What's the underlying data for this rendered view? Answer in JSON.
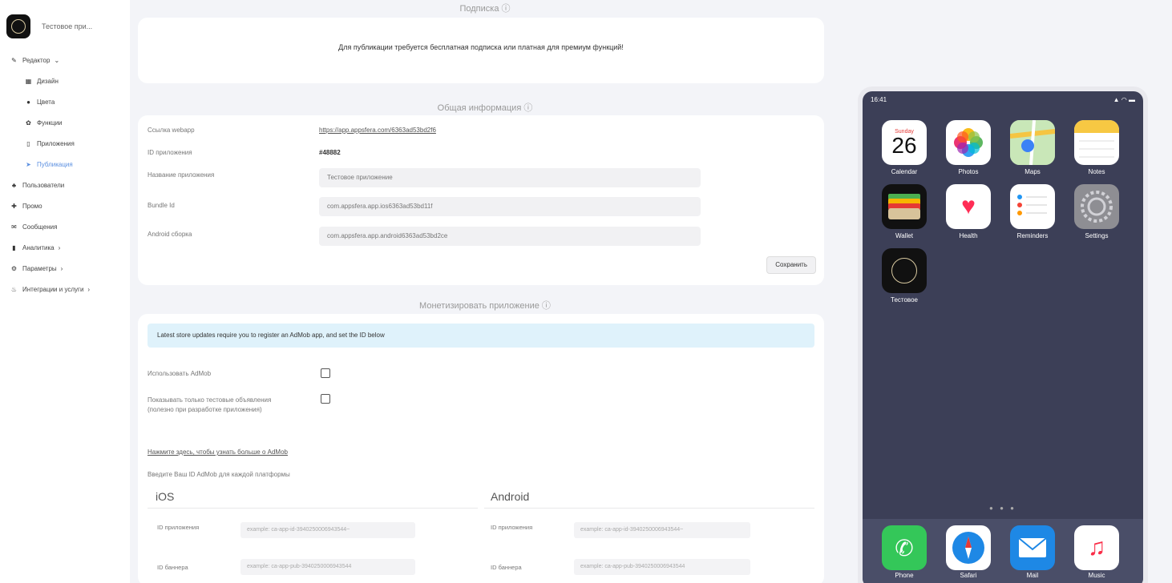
{
  "sidebar": {
    "app_name": "Тестовое при...",
    "items": [
      {
        "label": "Редактор",
        "icon": "✎",
        "chev": "⌄",
        "sub": false,
        "active": false
      },
      {
        "label": "Дизайн",
        "icon": "▦",
        "chev": "",
        "sub": true,
        "active": false
      },
      {
        "label": "Цвета",
        "icon": "●",
        "chev": "",
        "sub": true,
        "active": false
      },
      {
        "label": "Функции",
        "icon": "✿",
        "chev": "",
        "sub": true,
        "active": false
      },
      {
        "label": "Приложения",
        "icon": "▯",
        "chev": "",
        "sub": true,
        "active": false
      },
      {
        "label": "Публикация",
        "icon": "➤",
        "chev": "",
        "sub": true,
        "active": true
      },
      {
        "label": "Пользователи",
        "icon": "♣",
        "chev": "",
        "sub": false,
        "active": false
      },
      {
        "label": "Промо",
        "icon": "✚",
        "chev": "",
        "sub": false,
        "active": false
      },
      {
        "label": "Сообщения",
        "icon": "✉",
        "chev": "",
        "sub": false,
        "active": false
      },
      {
        "label": "Аналитика",
        "icon": "▮",
        "chev": "›",
        "sub": false,
        "active": false
      },
      {
        "label": "Параметры",
        "icon": "⚙",
        "chev": "›",
        "sub": false,
        "active": false
      },
      {
        "label": "Интеграции и услуги",
        "icon": "♨",
        "chev": "›",
        "sub": false,
        "active": false
      }
    ]
  },
  "subscription": {
    "title": "Подписка ⓘ",
    "notice": "Для публикации требуется бесплатная подписка или платная для премиум функций!"
  },
  "general": {
    "title": "Общая информация ⓘ",
    "webapp_label": "Ссылка webapp",
    "webapp_link": "https://app.appsfera.com/6363ad53bd2f6",
    "app_id_label": "ID приложения",
    "app_id_value": "#48882",
    "app_name_label": "Название приложения",
    "app_name_value": "Тестовое приложение",
    "bundle_label": "Bundle Id",
    "bundle_value": "com.appsfera.app.ios6363ad53bd11f",
    "android_label": "Android сборка",
    "android_value": "com.appsfera.app.android6363ad53bd2ce",
    "save_label": "Сохранить"
  },
  "monetize": {
    "title": "Монетизировать приложение ⓘ",
    "alert": "Latest store updates require you to register an AdMob app, and set the ID below",
    "use_admob_label": "Использовать AdMob",
    "test_ads_label": "Показывать только тестовые объявления (полезно при разработке приложения)",
    "learn_link": "Нажмите здесь, чтобы узнать больше о AdMob",
    "enter_ids_label": "Введите Ваш ID AdMob для каждой платформы",
    "ios": {
      "title": "iOS",
      "app_id_label": "ID приложения",
      "app_id_placeholder": "example: ca-app-id-3940250006943544~",
      "banner_label": "ID баннера",
      "banner_placeholder": "example: ca-app-pub-3940250006943544"
    },
    "android": {
      "title": "Android",
      "app_id_label": "ID приложения",
      "app_id_placeholder": "example: ca-app-id-3940250006943544~",
      "banner_label": "ID баннера",
      "banner_placeholder": "example: ca-app-pub-3940250006943544"
    }
  },
  "phone": {
    "time": "16:41",
    "signal": "▲ ◠ ▬",
    "calendar_day": "Sunday",
    "calendar_date": "26",
    "apps": [
      "Calendar",
      "Photos",
      "Maps",
      "Notes",
      "Wallet",
      "Health",
      "Reminders",
      "Settings",
      "Тестовое"
    ],
    "dock": [
      "Phone",
      "Safari",
      "Mail",
      "Music"
    ],
    "dots": "● ● ●"
  },
  "colors": {
    "accent": "#5a8fe0",
    "alert_bg": "#dff2fb",
    "phone_bg": "#3c3f57"
  }
}
